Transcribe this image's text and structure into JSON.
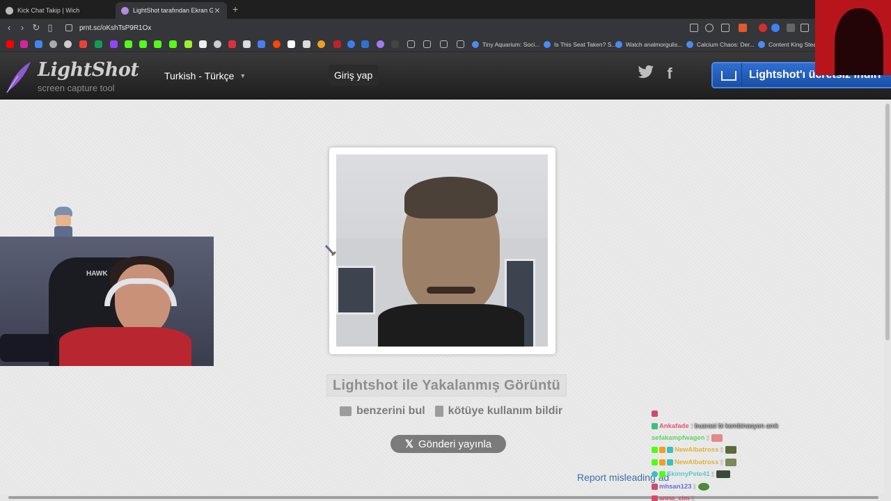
{
  "browser": {
    "tabs": [
      {
        "title": "Kick Chat Takip | Wich",
        "active": false
      },
      {
        "title": "LightShot tarafından Ekran Görü",
        "active": true
      }
    ],
    "url": "prnt.sc/oKshTsP9R1Ox",
    "bookmarks": [
      "Tiny Aquarium: Soci...",
      "Is This Seat Taken? S...",
      "Watch analmorgulis...",
      "Calcium Chaos: Der...",
      "Content King Steam"
    ]
  },
  "header": {
    "logo_name": "LightShot",
    "logo_tagline": "screen capture tool",
    "language": "Turkish - Türkçe",
    "login": "Giriş yap",
    "download": "Lightshot'ı ücretsiz indiri"
  },
  "main": {
    "caption": "Lightshot ile Yakalanmış Görüntü",
    "find_similar": "benzerini bul",
    "report_abuse": "kötüye kullanım bildir",
    "post_button": "Gönderi yayınla",
    "x_logo": "𝕏",
    "report_ad": "Report misleading ad"
  },
  "overlay": {
    "chair_brand": "HAWK",
    "chat": [
      {
        "user": "",
        "message": "",
        "user_color": "#d14a6a"
      },
      {
        "user": "Ankafade",
        "message": ": buarasi bi kombinasyon amk",
        "user_color": "#e0566b"
      },
      {
        "user": "sefakampfwagen",
        "message": ":",
        "user_color": "#5fd26a"
      },
      {
        "user": "NewAlbatross",
        "message": ":",
        "user_color": "#e0b23a"
      },
      {
        "user": "NewAlbatross",
        "message": ":",
        "user_color": "#e0b23a"
      },
      {
        "user": "SkinnyPete41",
        "message": ":",
        "user_color": "#58c9c9"
      },
      {
        "user": "mhsan123",
        "message": ":",
        "user_color": "#6a6ae0"
      },
      {
        "user": "anna_cim",
        "message": ":",
        "user_color": "#d14a6a"
      }
    ]
  }
}
